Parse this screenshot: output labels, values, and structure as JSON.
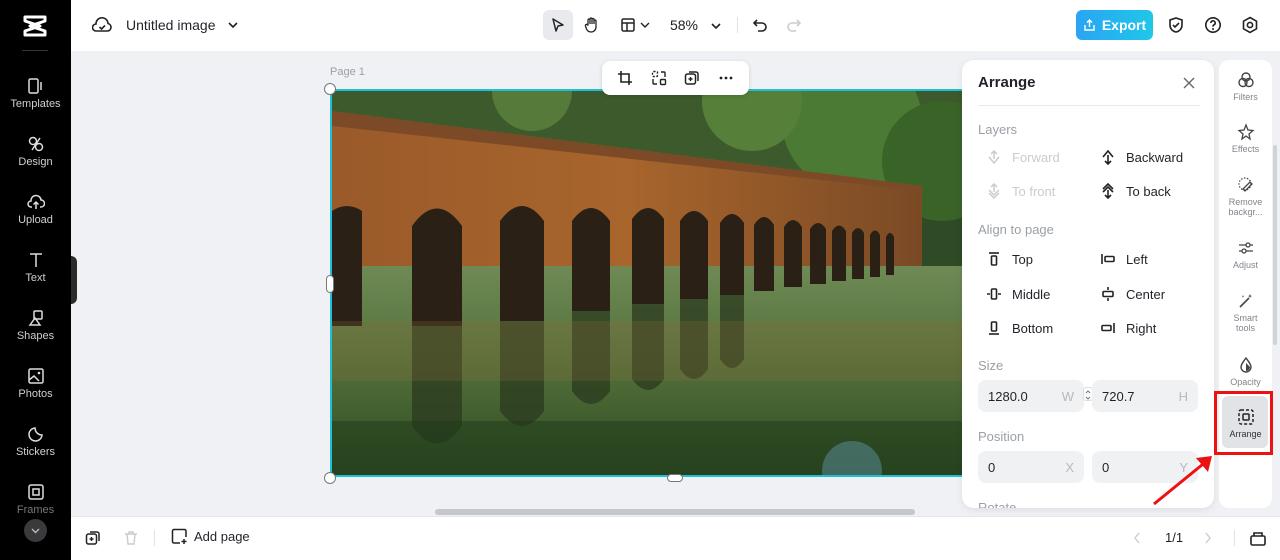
{
  "app": {
    "name": "CapCut"
  },
  "sidebar": {
    "items": [
      {
        "label": "Templates",
        "icon": "templates-icon"
      },
      {
        "label": "Design",
        "icon": "design-icon"
      },
      {
        "label": "Upload",
        "icon": "upload-icon"
      },
      {
        "label": "Text",
        "icon": "text-icon"
      },
      {
        "label": "Shapes",
        "icon": "shapes-icon"
      },
      {
        "label": "Photos",
        "icon": "photos-icon"
      },
      {
        "label": "Stickers",
        "icon": "stickers-icon"
      },
      {
        "label": "Frames",
        "icon": "frames-icon"
      }
    ]
  },
  "header": {
    "title": "Untitled image",
    "zoom": "58%",
    "export_label": "Export"
  },
  "canvas": {
    "page_label": "Page 1"
  },
  "arrange_panel": {
    "title": "Arrange",
    "layers_label": "Layers",
    "layers": {
      "forward": "Forward",
      "backward": "Backward",
      "to_front": "To front",
      "to_back": "To back"
    },
    "align_label": "Align to page",
    "align": {
      "top": "Top",
      "left": "Left",
      "middle": "Middle",
      "center": "Center",
      "bottom": "Bottom",
      "right": "Right"
    },
    "size_label": "Size",
    "width": "1280.0",
    "width_unit": "W",
    "height": "720.7",
    "height_unit": "H",
    "position_label": "Position",
    "x": "0",
    "x_unit": "X",
    "y": "0",
    "y_unit": "Y",
    "rotate_label": "Rotate"
  },
  "right_rail": {
    "items": [
      {
        "label": "Filters"
      },
      {
        "label": "Effects"
      },
      {
        "label": "Remove backgr..."
      },
      {
        "label": "Adjust"
      },
      {
        "label": "Smart tools"
      },
      {
        "label": "Opacity"
      },
      {
        "label": "Arrange"
      }
    ]
  },
  "bottombar": {
    "add_page_label": "Add page",
    "page_indicator": "1/1"
  },
  "colors": {
    "accent": "#1ec0d8",
    "export_gradient_start": "#2aa4f4",
    "export_gradient_end": "#1fc7e8",
    "annotation_red": "#ee1111"
  }
}
